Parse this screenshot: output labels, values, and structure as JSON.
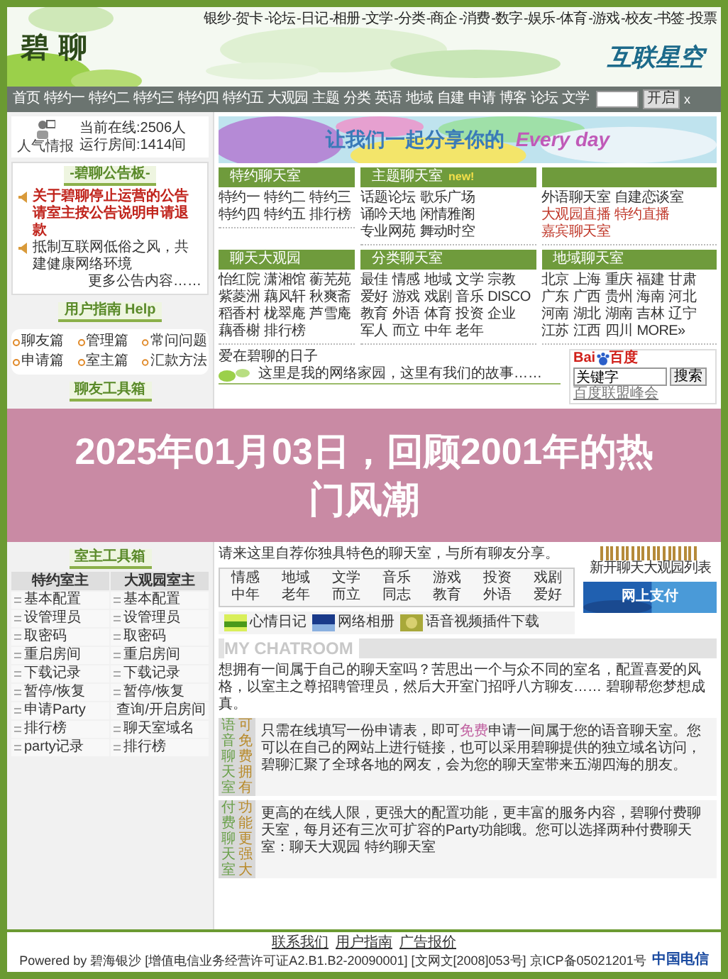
{
  "top_links": [
    "银纱",
    "-贺卡",
    "-论坛",
    "-日记",
    "-相册",
    "-文学",
    "-分类",
    "-商企",
    "-消费",
    "-数字",
    "-娱乐",
    "-体育",
    "-游戏",
    "-校友",
    "-书签",
    "-投票"
  ],
  "header": {
    "logo": "碧 聊",
    "partner_logo": "互联星空"
  },
  "nav": {
    "items": [
      "首页",
      "特约一",
      "特约二",
      "特约三",
      "特约四",
      "特约五",
      "大观园",
      "主题",
      "分类",
      "英语",
      "地域",
      "自建",
      "申请",
      "博客",
      "论坛",
      "文学"
    ],
    "button": "开启",
    "close": "x"
  },
  "stats": {
    "label": "人气情报",
    "lines": [
      "当前在线:2506人",
      "运行房间:1414间"
    ]
  },
  "notice_board": {
    "title": "-碧聊公告板-",
    "items": [
      {
        "kind": "alert",
        "lines": [
          "关于碧聊停止运营的公告",
          "请室主按公告说明申请退款"
        ]
      },
      {
        "kind": "normal",
        "lines": [
          "抵制互联网低俗之风，共建健康网络环境"
        ]
      }
    ],
    "more": "更多公告内容……"
  },
  "help": {
    "title": "用户指南 Help",
    "links": [
      "聊友篇",
      "管理篇",
      "常问问题",
      "申请篇",
      "室主篇",
      "汇款方法"
    ]
  },
  "toolbox": {
    "title": "聊友工具箱"
  },
  "banner": {
    "text_1": "让我们一起分享你的",
    "text_2": "Every day"
  },
  "sections": [
    {
      "title": "特约聊天室",
      "rows": [
        [
          "特约一",
          "特约二",
          "特约三"
        ],
        [
          "特约四",
          "特约五",
          "排行榜"
        ]
      ]
    },
    {
      "title": "主题聊天室",
      "badge": "new!",
      "rows": [
        [
          "话题论坛",
          "歌乐广场"
        ],
        [
          "诵吟天地",
          "闲情雅阁"
        ],
        [
          "专业网苑",
          "舞动时空"
        ]
      ]
    },
    {
      "rows": [
        [
          {
            "text": "外语聊天室",
            "color": "#333333"
          },
          {
            "text": "自建恋谈室",
            "color": "#333333"
          }
        ],
        [
          {
            "text": "大观园直播",
            "color": "#c0392b"
          },
          {
            "text": "特约直播",
            "color": "#c0392b"
          }
        ],
        [
          {
            "text": "嘉宾聊天室",
            "color": "#c0392b"
          }
        ]
      ]
    },
    {
      "title": "聊天大观园",
      "rows": [
        [
          "怡红院",
          "潇湘馆",
          "蘅芜苑"
        ],
        [
          "紫菱洲",
          "藕风轩",
          "秋爽斋"
        ],
        [
          "稻香村",
          "栊翠庵",
          "芦雪庵"
        ],
        [
          "藕香榭",
          "排行榜"
        ]
      ]
    },
    {
      "title": "分类聊天室",
      "rows": [
        [
          "最佳",
          "情感",
          "地域",
          "文学",
          "宗教"
        ],
        [
          "爱好",
          "游戏",
          "戏剧",
          "音乐",
          "DISCO"
        ],
        [
          "教育",
          "外语",
          "体育",
          "投资",
          "企业"
        ],
        [
          "军人",
          "而立",
          "中年",
          "老年"
        ]
      ]
    },
    {
      "title": "地域聊天室",
      "rows": [
        [
          "北京",
          "上海",
          "重庆",
          "福建",
          "甘肃"
        ],
        [
          "广东",
          "广西",
          "贵州",
          "海南",
          "河北"
        ],
        [
          "河南",
          "湖北",
          "湖南",
          "吉林",
          "辽宁"
        ],
        [
          "江苏",
          "江西",
          "四川",
          "MORE»"
        ]
      ]
    }
  ],
  "diary": {
    "title": "爱在碧聊的日子",
    "text": "这里是我的网络家园，这里有我们的故事……"
  },
  "baidu": {
    "logo_1": "Bai",
    "logo_2": "百度",
    "input": "关键字",
    "button": "搜索",
    "link": "百度联盟峰会"
  },
  "overlay_title": "2025年01月03日，回顾2001年的热门风潮",
  "owner_toolbox": {
    "title": "室主工具箱",
    "columns": [
      "特约室主",
      "大观园室主"
    ],
    "rows": [
      [
        "基本配置",
        "基本配置"
      ],
      [
        "设管理员",
        "设管理员"
      ],
      [
        "取密码",
        "取密码"
      ],
      [
        "重启房间",
        "重启房间"
      ],
      [
        "下载记录",
        "下载记录"
      ],
      [
        "暂停/恢复",
        "暂停/恢复"
      ],
      [
        "申请Party",
        "查询/开启房间"
      ],
      [
        "排行榜",
        "聊天室域名"
      ],
      [
        "party记录",
        "排行榜"
      ]
    ]
  },
  "featured": {
    "intro": "请来这里自荐你独具特色的聊天室，与所有聊友分享。",
    "rows": [
      [
        "情感",
        "地域",
        "文学",
        "音乐",
        "游戏",
        "投资",
        "戏剧"
      ],
      [
        "中年",
        "老年",
        "而立",
        "同志",
        "教育",
        "外语",
        "爱好"
      ]
    ]
  },
  "side_ads": [
    "新开聊天大观园列表",
    "网上支付"
  ],
  "quick_links": [
    "心情日记",
    "网络相册",
    "语音视频插件下载"
  ],
  "chatroom": {
    "title": "MY CHATROOM",
    "intro": "想拥有一间属于自己的聊天室吗？苦思出一个与众不同的室名，配置喜爱的风格，以室主之尊招聘管理员，然后大开室门招呼八方聊友…… 碧聊帮您梦想成真。",
    "offers": [
      {
        "label_1": "语音聊天室",
        "label_2": "可免费拥有",
        "text": "只需在线填写一份申请表，即可**免费**申请一间属于您的语音聊天室。您可以在自己的网站上进行链接，也可以采用碧聊提供的独立域名访问，碧聊汇聚了全球各地的网友，会为您的聊天室带来五湖四海的朋友。"
      },
      {
        "label_1": "付费聊天室",
        "label_2": "功能更强大",
        "text": "更高的在线人限，更强大的配置功能，更丰富的服务内容，碧聊付费聊天室，每月还有三次可扩容的Party功能哦。您可以选择两种付费聊天室：聊天大观园 特约聊天室"
      }
    ]
  },
  "footer": {
    "links": [
      "联系我们",
      "用户指南",
      "广告报价"
    ],
    "powered": "Powered by 碧海银沙 [增值电信业务经营许可证A2.B1.B2-20090001] [文网文[2008]053号] 京ICP备05021201号",
    "telecom": "中国电信"
  }
}
